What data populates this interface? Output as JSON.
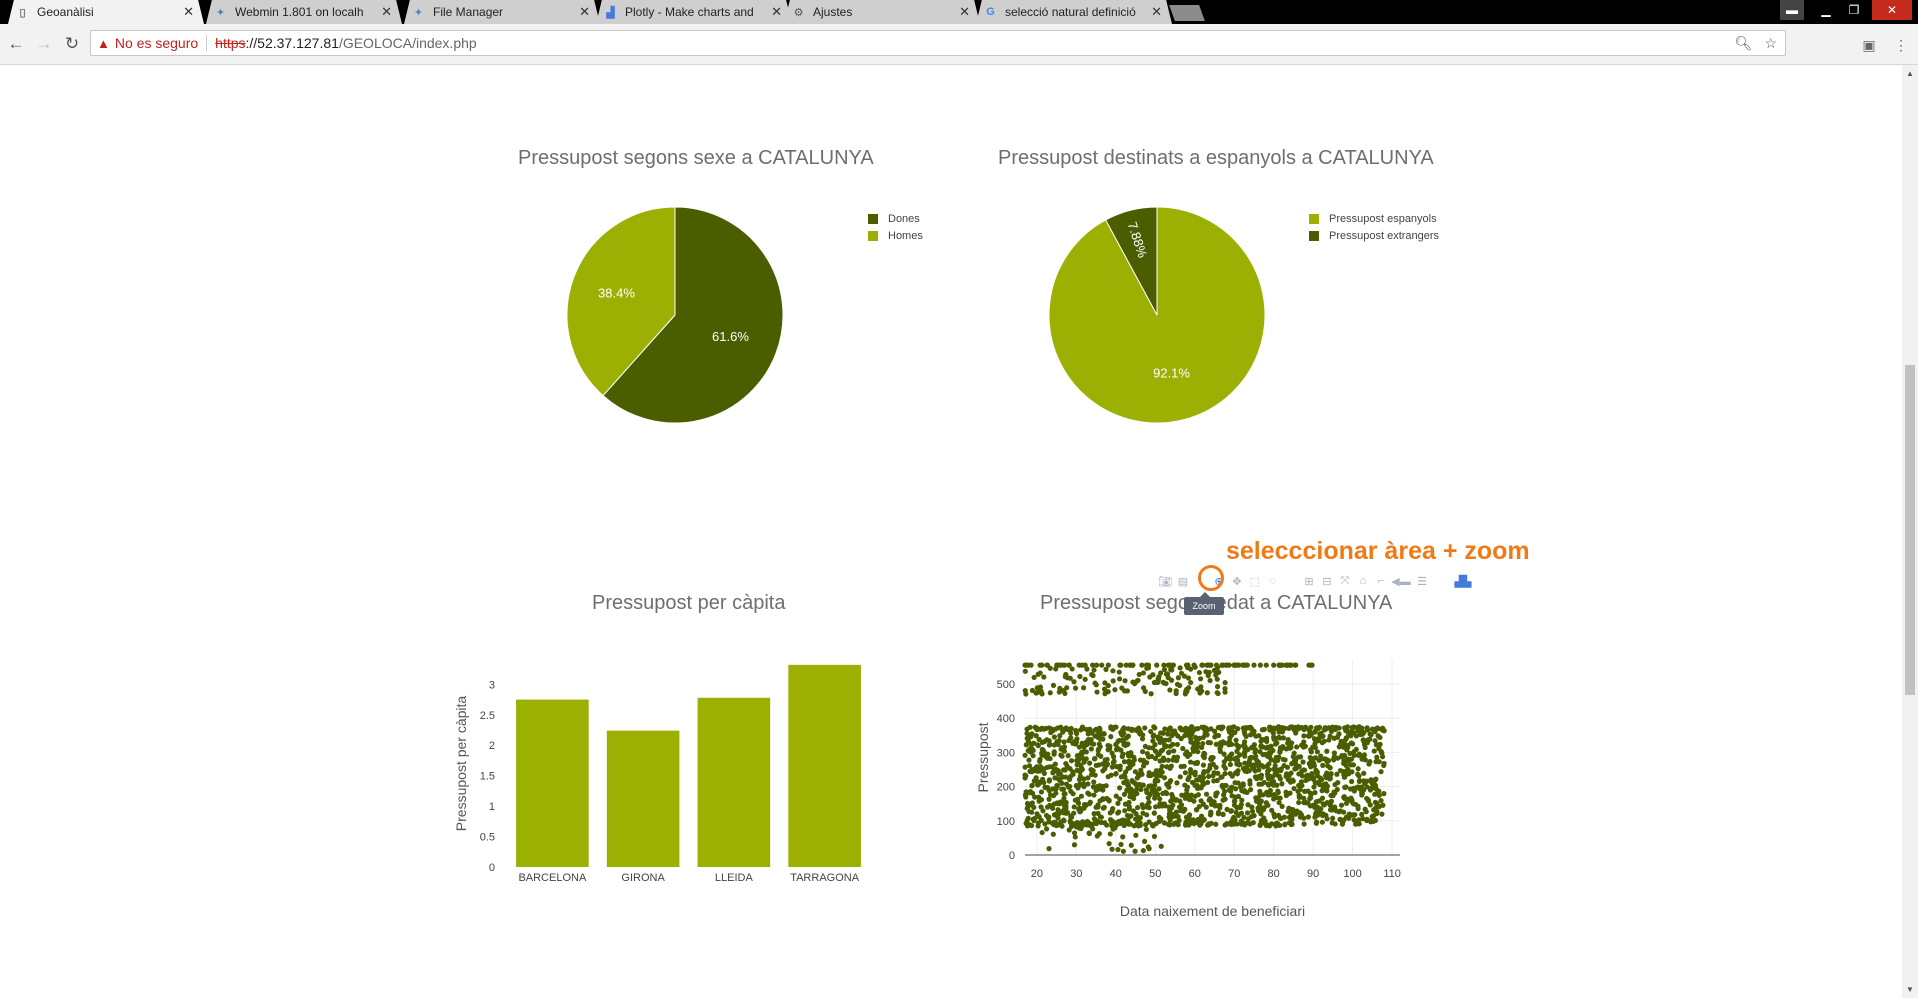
{
  "browser": {
    "tabs": [
      {
        "label": "Geoanàlisi",
        "icon": "page-icon",
        "active": true
      },
      {
        "label": "Webmin 1.801 on localh",
        "icon": "webmin-icon",
        "active": false
      },
      {
        "label": "File Manager",
        "icon": "webmin-icon",
        "active": false
      },
      {
        "label": "Plotly - Make charts and",
        "icon": "plotly-icon",
        "active": false
      },
      {
        "label": "Ajustes",
        "icon": "gear-icon",
        "active": false
      },
      {
        "label": "selecció natural definició",
        "icon": "google-icon",
        "active": false
      }
    ],
    "address": {
      "warning": "No es seguro",
      "scheme": "https",
      "host": "://52.37.127.81",
      "path": "/GEOLOCA/index.php"
    }
  },
  "colors": {
    "dark_green": "#4a5e00",
    "light_green": "#9cb004",
    "annotation": "#f07b16"
  },
  "charts": {
    "sex": {
      "title": "Pressupost segons sexe a CATALUNYA",
      "legend": [
        "Dones",
        "Homes"
      ]
    },
    "nationality": {
      "title": "Pressupost destinats a espanyols a CATALUNYA",
      "legend": [
        "Pressupost espanyols",
        "Pressupost extrangers"
      ]
    },
    "capita": {
      "title": "Pressupost per càpita"
    },
    "age": {
      "title": "Pressupost segons edat a CATALUNYA"
    }
  },
  "modebar": {
    "tooltip": "Zoom",
    "annotation": "selecccionar àrea + zoom"
  },
  "chart_data": [
    {
      "type": "pie",
      "title": "Pressupost segons sexe a CATALUNYA",
      "labels": [
        "Dones",
        "Homes"
      ],
      "values": [
        61.6,
        38.4
      ],
      "value_labels": [
        "61.6%",
        "38.4%"
      ],
      "colors": [
        "#4a5e00",
        "#9cb004"
      ],
      "legend": "right"
    },
    {
      "type": "pie",
      "title": "Pressupost destinats a espanyols a CATALUNYA",
      "labels": [
        "Pressupost espanyols",
        "Pressupost extrangers"
      ],
      "values": [
        92.1,
        7.88
      ],
      "value_labels": [
        "92.1%",
        "7.88%"
      ],
      "colors": [
        "#9cb004",
        "#4a5e00"
      ],
      "legend": "right"
    },
    {
      "type": "bar",
      "title": "Pressupost per càpita",
      "categories": [
        "BARCELONA",
        "GIRONA",
        "LLEIDA",
        "TARRAGONA"
      ],
      "values": [
        2.75,
        2.24,
        2.78,
        3.32
      ],
      "ylabel": "Pressupost per càpita",
      "xlabel": "",
      "ylim": [
        0,
        3.4
      ],
      "yticks": [
        "0",
        "0.5",
        "1",
        "1.5",
        "2",
        "2.5",
        "3"
      ],
      "color": "#9cb004"
    },
    {
      "type": "scatter",
      "title": "Pressupost segons edat a CATALUNYA",
      "xlabel": "Data naixement de beneficiari",
      "ylabel": "Pressupost",
      "xlim": [
        17,
        112
      ],
      "ylim": [
        0,
        570
      ],
      "xticks": [
        "20",
        "30",
        "40",
        "50",
        "60",
        "70",
        "80",
        "90",
        "100",
        "110"
      ],
      "yticks": [
        "0",
        "100",
        "200",
        "300",
        "400",
        "500"
      ],
      "color": "#4a5e00",
      "grid": true,
      "clusters": [
        {
          "x": [
            17,
            90
          ],
          "y": [
            555,
            555
          ],
          "n": 90
        },
        {
          "x": [
            17,
            68
          ],
          "y": [
            470,
            550
          ],
          "n": 130
        },
        {
          "x": [
            17,
            108
          ],
          "y": [
            365,
            375
          ],
          "n": 160
        },
        {
          "x": [
            17,
            108
          ],
          "y": [
            90,
            365
          ],
          "n": 1500
        },
        {
          "x": [
            17,
            85
          ],
          "y": [
            85,
            95
          ],
          "n": 90
        },
        {
          "x": [
            20,
            55
          ],
          "y": [
            10,
            85
          ],
          "n": 40
        }
      ]
    }
  ]
}
